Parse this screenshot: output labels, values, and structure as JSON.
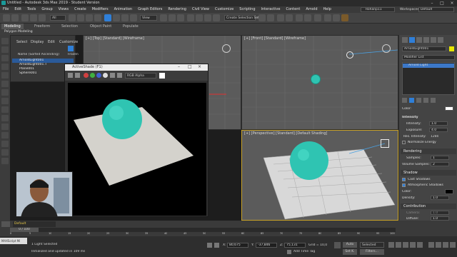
{
  "window": {
    "title": "Untitled - Autodesk 3ds Max 2019 - Student Version",
    "user": "Rohanp11",
    "workspaces_label": "Workspaces:",
    "workspace_value": "Default"
  },
  "menu": [
    "File",
    "Edit",
    "Tools",
    "Group",
    "Views",
    "Create",
    "Modifiers",
    "Animation",
    "Graph Editors",
    "Rendering",
    "Civil View",
    "Customize",
    "Scripting",
    "Interactive",
    "Content",
    "Arnold",
    "Help"
  ],
  "toolbar": {
    "all_label": "All",
    "view_label": "View",
    "selection_set": "Create Selection Set"
  },
  "ribbon": {
    "tabs": [
      "Modeling",
      "Freeform",
      "Selection",
      "Object Paint",
      "Populate"
    ],
    "sub_label": "Polygon Modeling"
  },
  "explorer": {
    "menu": [
      "Select",
      "Display",
      "Edit",
      "Customize"
    ],
    "column_header": "Name (Sorted Ascending)",
    "frozen_label": "Frozen",
    "rows": [
      "ArnoldLight001",
      "ArnoldLight001.T",
      "Plane001",
      "Sphere001"
    ]
  },
  "viewports": {
    "top": "[+] [Top] [Standard] [Wireframe]",
    "front": "[+] [Front] [Standard] [Wireframe]",
    "perspective": "[+] [Perspective] [Standard] [Default Shading]"
  },
  "activeshade": {
    "title": "ActiveShade (F1)",
    "channel": "RGB Alpha"
  },
  "command_panel": {
    "object_name": "ArnoldLight001",
    "modifier_list": "Modifier List",
    "stack_item": "Arnold Light",
    "color_label": "Color:",
    "intensity_header": "Intensity",
    "intensity_label": "Intensity:",
    "intensity_value": "1.0",
    "exposure_label": "Exposure:",
    "exposure_value": "4.0",
    "res_intensity_label": "Res. Intensity:",
    "res_intensity_value": "1280",
    "normalize_label": "Normalize Energy",
    "rendering_header": "Rendering",
    "samples_label": "Samples:",
    "samples_value": "1",
    "volume_samples_label": "Volume Samples:",
    "volume_samples_value": "2",
    "shadow_header": "Shadow",
    "cast_shadows": "Cast Shadows",
    "atmospheric_shadows": "Atmospheric Shadows",
    "shadow_color_label": "Color:",
    "density_label": "Density:",
    "density_value": "1.0",
    "contribution_header": "Contribution",
    "camera_label": "Camera:",
    "camera_value": "1.0",
    "diffuse_label": "Diffuse:",
    "diffuse_value": "1.0"
  },
  "timeline": {
    "layer": "Default",
    "frame": "0 / 100",
    "ticks": [
      "0",
      "5",
      "10",
      "15",
      "20",
      "25",
      "30",
      "35",
      "40",
      "45",
      "50",
      "55",
      "60",
      "65",
      "70",
      "75",
      "80",
      "85",
      "90",
      "95",
      "100"
    ]
  },
  "status": {
    "selection": "1 Light Selected",
    "info": "Initialized and updated in 109 ms",
    "x_label": "X:",
    "x_value": "80,675",
    "y_label": "Y:",
    "y_value": "-37,846",
    "z_label": "Z:",
    "z_value": "75,131",
    "grid": "Grid = 10,0",
    "add_time_tag": "Add Time Tag",
    "auto": "Auto",
    "set_k": "Set K.",
    "selected": "Selected",
    "filters": "Filters..."
  },
  "colors": {
    "sphere": "#2fc4b2",
    "accent_blue": "#2f7fd8",
    "yellow_border": "#c8a227",
    "active_stack": "#3c78c8"
  }
}
